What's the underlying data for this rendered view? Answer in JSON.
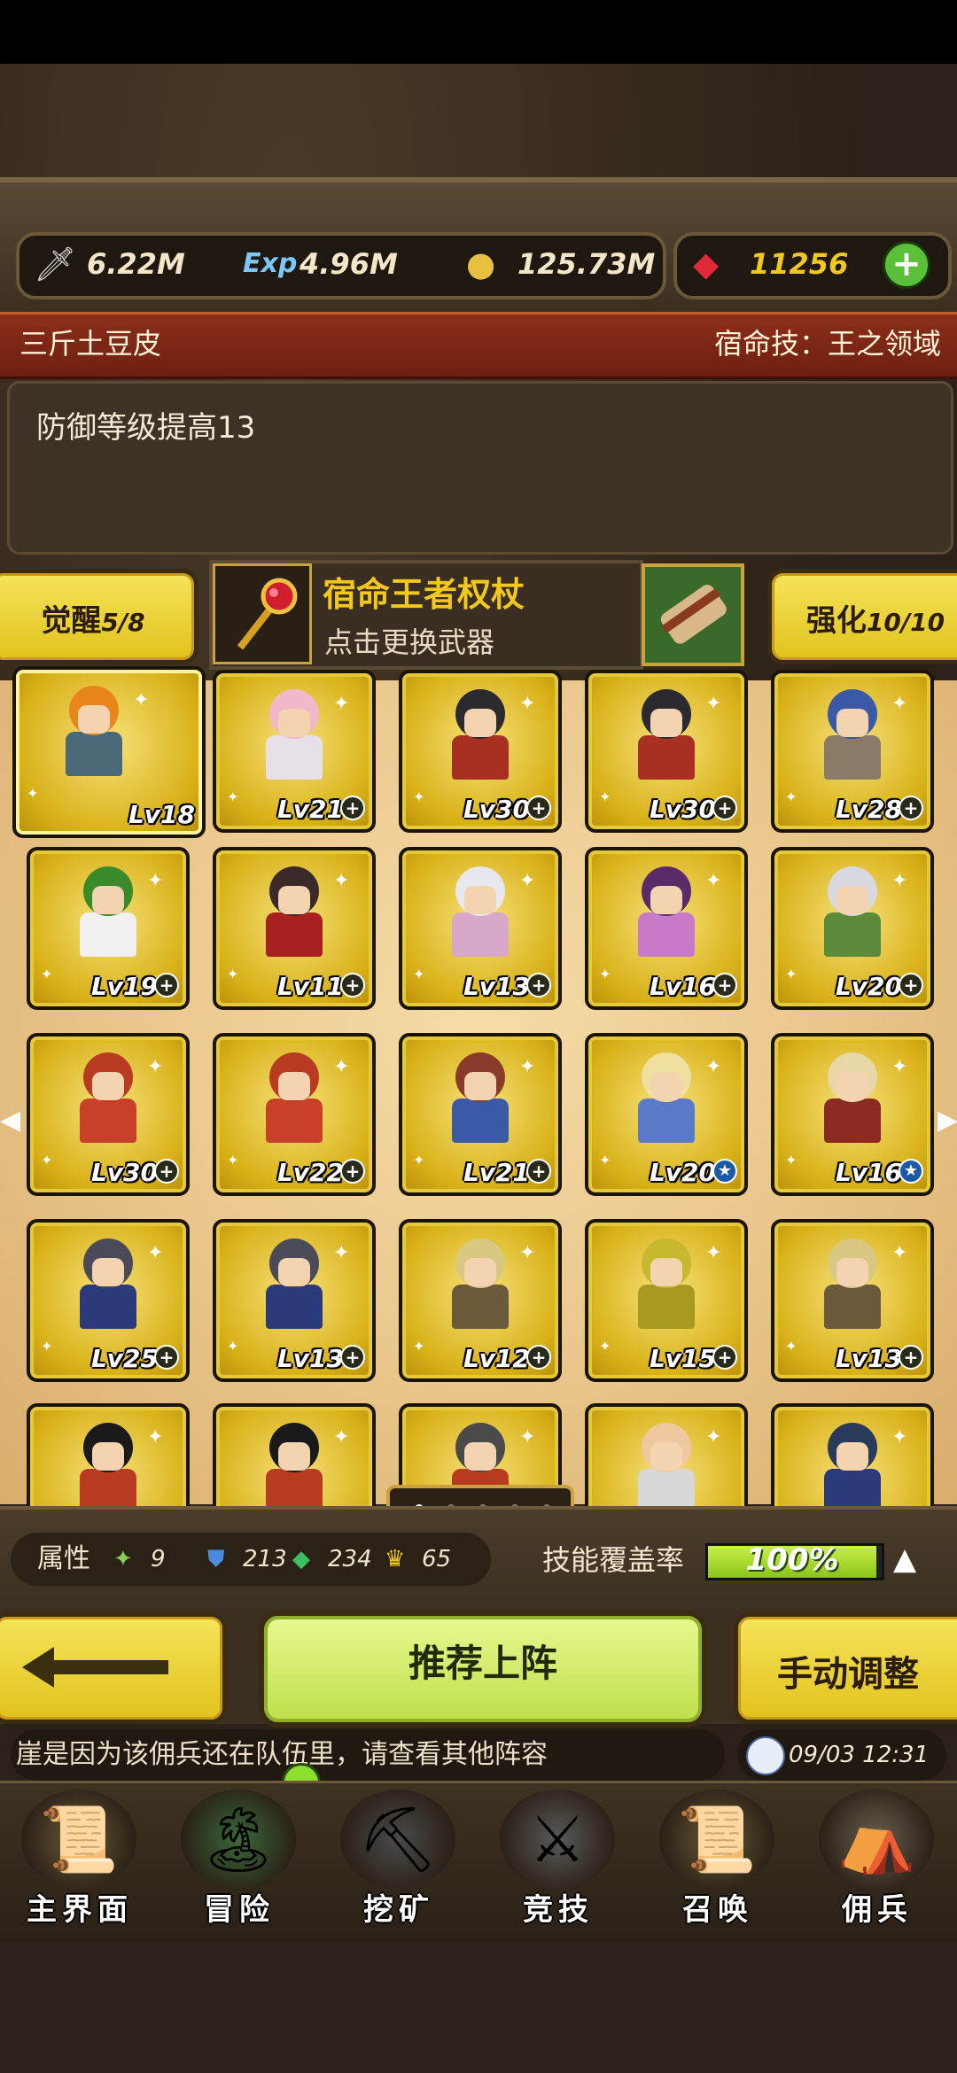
{
  "resources": {
    "attack": "6.22M",
    "exp_label": "Exp",
    "exp": "4.96M",
    "gold": "125.73M",
    "gems": "11256",
    "add_label": "+"
  },
  "hero": {
    "name": "三斤土豆皮",
    "skill": "宿命技：王之领域",
    "description": "防御等级提高13"
  },
  "awaken": {
    "label": "觉醒",
    "value": "5/8"
  },
  "weapon": {
    "name": "宿命王者权杖",
    "hint": "点击更换武器"
  },
  "enhance": {
    "label": "强化",
    "value": "10/10"
  },
  "heroes": [
    {
      "level": "Lv18",
      "badge": "none",
      "hair": "#e8861c",
      "cloth": "#4a6a7a"
    },
    {
      "level": "Lv21",
      "badge": "plus",
      "hair": "#f0b8c8",
      "cloth": "#e8e0e8"
    },
    {
      "level": "Lv30",
      "badge": "plus",
      "hair": "#2a2a30",
      "cloth": "#a83020"
    },
    {
      "level": "Lv30",
      "badge": "plus",
      "hair": "#2a2a30",
      "cloth": "#a83020"
    },
    {
      "level": "Lv28",
      "badge": "plus",
      "hair": "#3a5aa8",
      "cloth": "#8a7a68"
    },
    {
      "level": "Lv19",
      "badge": "plus",
      "hair": "#3a8a2a",
      "cloth": "#f0f0f0"
    },
    {
      "level": "Lv11",
      "badge": "plus",
      "hair": "#3a2a2a",
      "cloth": "#a82020"
    },
    {
      "level": "Lv13",
      "badge": "plus",
      "hair": "#e8e8f0",
      "cloth": "#d8a8c8"
    },
    {
      "level": "Lv16",
      "badge": "plus",
      "hair": "#5a2a6a",
      "cloth": "#c87ac8"
    },
    {
      "level": "Lv20",
      "badge": "plus",
      "hair": "#d8d8e0",
      "cloth": "#5a8a3a"
    },
    {
      "level": "Lv30",
      "badge": "plus",
      "hair": "#b83a20",
      "cloth": "#c84028"
    },
    {
      "level": "Lv22",
      "badge": "plus",
      "hair": "#b83a20",
      "cloth": "#c84028"
    },
    {
      "level": "Lv21",
      "badge": "plus",
      "hair": "#8a3a2a",
      "cloth": "#3a5aa8"
    },
    {
      "level": "Lv20",
      "badge": "star",
      "hair": "#f0e0a0",
      "cloth": "#5a7ac8"
    },
    {
      "level": "Lv16",
      "badge": "star",
      "hair": "#e8d8a8",
      "cloth": "#8a2a20"
    },
    {
      "level": "Lv25",
      "badge": "plus",
      "hair": "#4a4a58",
      "cloth": "#2a3a7a"
    },
    {
      "level": "Lv13",
      "badge": "plus",
      "hair": "#4a4a58",
      "cloth": "#2a3a7a"
    },
    {
      "level": "Lv12",
      "badge": "plus",
      "hair": "#d8c880",
      "cloth": "#6a5a3a"
    },
    {
      "level": "Lv15",
      "badge": "plus",
      "hair": "#c8b830",
      "cloth": "#a89a20"
    },
    {
      "level": "Lv13",
      "badge": "plus",
      "hair": "#d8c880",
      "cloth": "#6a5a3a"
    },
    {
      "level": "",
      "badge": "none",
      "hair": "#1a1a1a",
      "cloth": "#b83a20"
    },
    {
      "level": "",
      "badge": "none",
      "hair": "#1a1a1a",
      "cloth": "#b83a20"
    },
    {
      "level": "",
      "badge": "none",
      "hair": "#4a4a4a",
      "cloth": "#b83a20"
    },
    {
      "level": "",
      "badge": "none",
      "hair": "#f0c8a0",
      "cloth": "#d8d8d8"
    },
    {
      "level": "",
      "badge": "none",
      "hair": "#2a3a5a",
      "cloth": "#2a3a7a"
    }
  ],
  "stats": {
    "label": "属性",
    "speed": "9",
    "defense": "213",
    "gem_stat": "234",
    "crown": "65",
    "coverage_label": "技能覆盖率",
    "coverage": "100%",
    "coverage_fraction": 1.0
  },
  "buttons": {
    "recommend": "推荐上阵",
    "manual": "手动调整"
  },
  "message": "崖是因为该佣兵还在队伍里，请查看其他阵容",
  "time": "09/03 12:31",
  "nav": [
    {
      "label": "主界面",
      "icon": "map-scroll-icon"
    },
    {
      "label": "冒险",
      "icon": "island-icon"
    },
    {
      "label": "挖矿",
      "icon": "pickaxe-icon"
    },
    {
      "label": "竞技",
      "icon": "crossed-swords-icon"
    },
    {
      "label": "召唤",
      "icon": "summon-scroll-icon"
    },
    {
      "label": "佣兵",
      "icon": "tent-icon"
    }
  ],
  "colors": {
    "gold": "#e1c21c",
    "title_red": "#8b2e1a",
    "green_button": "#bde04a"
  }
}
